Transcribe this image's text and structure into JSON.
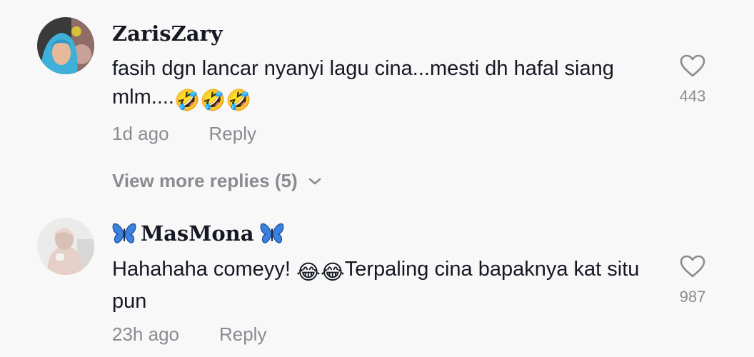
{
  "comments": [
    {
      "username": "ZarisZary",
      "text": "fasih dgn lancar nyanyi lagu cina...mesti dh hafal siang mlm....",
      "emoji": "🤣🤣🤣",
      "time": "1d ago",
      "reply_label": "Reply",
      "likes": "443"
    },
    {
      "username": "MasMona",
      "username_decoration": "butterfly-icon",
      "text_before": "Hahahaha comeyy! ",
      "emoji": "😂😂",
      "text_after": "Terpaling cina bapaknya kat situ pun",
      "time": "23h ago",
      "reply_label": "Reply",
      "likes": "987"
    }
  ],
  "view_more": {
    "label": "View more replies (5)",
    "icon": "chevron-down-icon"
  },
  "colors": {
    "background": "#f8f8f8",
    "primary_text": "#161823",
    "secondary_text": "#8a8b91",
    "butterfly": "#3b82e0"
  }
}
